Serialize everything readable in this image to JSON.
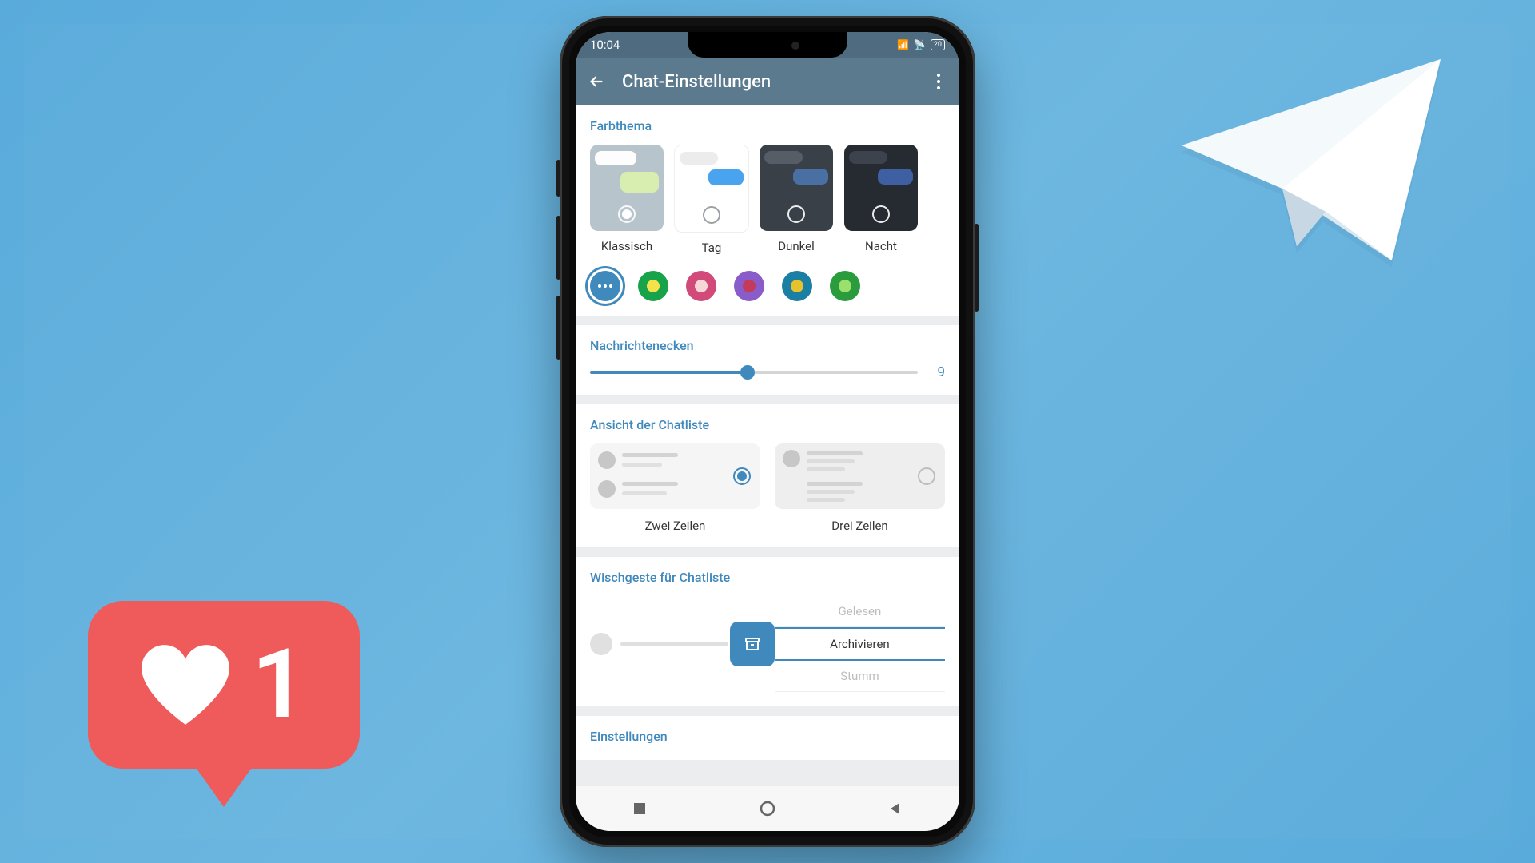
{
  "statusbar": {
    "time": "10:04",
    "battery": "20"
  },
  "header": {
    "title": "Chat-Einstellungen"
  },
  "sections": {
    "farbthema": {
      "label": "Farbthema",
      "themes": [
        {
          "label": "Klassisch"
        },
        {
          "label": "Tag"
        },
        {
          "label": "Dunkel"
        },
        {
          "label": "Nacht"
        }
      ],
      "selected_theme": 0,
      "accent_colors": [
        {
          "bg": "#3f89bd",
          "inner": "#1e5d88"
        },
        {
          "bg": "#17a34a",
          "inner": "#f3e24b"
        },
        {
          "bg": "#d14a7a",
          "inner": "#f7d6d6"
        },
        {
          "bg": "#8a5cc9",
          "inner": "#c23b5a"
        },
        {
          "bg": "#1b7fa3",
          "inner": "#e7c22b"
        },
        {
          "bg": "#2a9c3d",
          "inner": "#9be06b"
        }
      ],
      "selected_accent": 0
    },
    "nachrichtenecken": {
      "label": "Nachrichtenecken",
      "value": "9",
      "percent": 48
    },
    "chatliste": {
      "label": "Ansicht der Chatliste",
      "options": [
        {
          "label": "Zwei Zeilen"
        },
        {
          "label": "Drei Zeilen"
        }
      ],
      "selected": 0
    },
    "wischgeste": {
      "label": "Wischgeste für Chatliste",
      "options": [
        {
          "label": "Gelesen"
        },
        {
          "label": "Archivieren"
        },
        {
          "label": "Stumm"
        }
      ],
      "selected": 1
    },
    "einstellungen": {
      "label": "Einstellungen"
    }
  },
  "like": {
    "count": "1"
  }
}
